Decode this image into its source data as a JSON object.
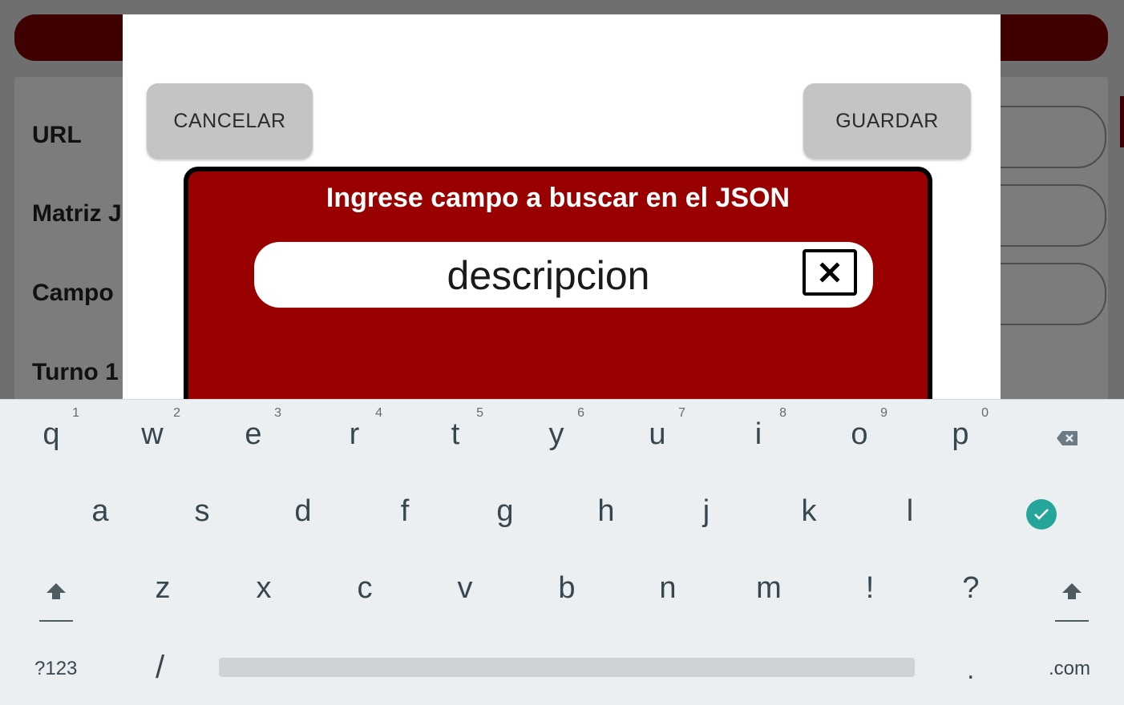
{
  "background": {
    "labels": [
      "URL",
      "Matriz J",
      "Campo",
      "Turno 1"
    ]
  },
  "dialog": {
    "cancel_label": "CANCELAR",
    "save_label": "GUARDAR",
    "prompt": "Ingrese campo a buscar en el JSON",
    "search_value": "descripcion"
  },
  "keyboard": {
    "row1": [
      {
        "key": "q",
        "hint": "1"
      },
      {
        "key": "w",
        "hint": "2"
      },
      {
        "key": "e",
        "hint": "3"
      },
      {
        "key": "r",
        "hint": "4"
      },
      {
        "key": "t",
        "hint": "5"
      },
      {
        "key": "y",
        "hint": "6"
      },
      {
        "key": "u",
        "hint": "7"
      },
      {
        "key": "i",
        "hint": "8"
      },
      {
        "key": "o",
        "hint": "9"
      },
      {
        "key": "p",
        "hint": "0"
      }
    ],
    "row2": [
      "a",
      "s",
      "d",
      "f",
      "g",
      "h",
      "j",
      "k",
      "l"
    ],
    "row3": [
      "z",
      "x",
      "c",
      "v",
      "b",
      "n",
      "m",
      "!",
      "?"
    ],
    "symbols_label": "?123",
    "slash_label": "/",
    "period_label": ".",
    "dotcom_label": ".com",
    "colors": {
      "enter": "#26a69a",
      "background": "#eceff1"
    },
    "icons": [
      "backspace-icon",
      "enter-check-icon",
      "shift-left-icon",
      "shift-right-icon"
    ]
  },
  "colors": {
    "accent_red": "#990000",
    "dark_red": "#3e0000"
  }
}
